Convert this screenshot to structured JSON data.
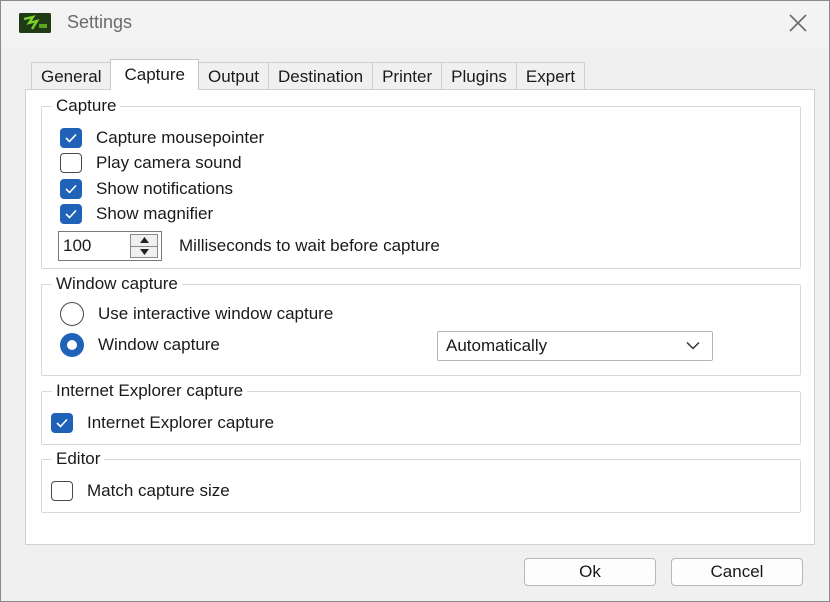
{
  "window": {
    "title": "Settings",
    "icons": {
      "app": "greenshot-app-icon",
      "close": "close-icon"
    }
  },
  "tabs": [
    {
      "label": "General",
      "active": false
    },
    {
      "label": "Capture",
      "active": true
    },
    {
      "label": "Output",
      "active": false
    },
    {
      "label": "Destination",
      "active": false
    },
    {
      "label": "Printer",
      "active": false
    },
    {
      "label": "Plugins",
      "active": false
    },
    {
      "label": "Expert",
      "active": false
    }
  ],
  "capture": {
    "group_label": "Capture",
    "capture_mousepointer": {
      "label": "Capture mousepointer",
      "checked": true
    },
    "play_camera_sound": {
      "label": "Play camera sound",
      "checked": false
    },
    "show_notifications": {
      "label": "Show notifications",
      "checked": true
    },
    "show_magnifier": {
      "label": "Show magnifier",
      "checked": true
    },
    "wait": {
      "value": "100",
      "label": "Milliseconds to wait before capture"
    }
  },
  "window_capture": {
    "group_label": "Window capture",
    "interactive": {
      "label": "Use interactive window capture",
      "selected": false
    },
    "window": {
      "label": "Window capture",
      "selected": true
    },
    "mode": {
      "selected": "Automatically"
    }
  },
  "ie_capture": {
    "group_label": "Internet Explorer capture",
    "checkbox": {
      "label": "Internet Explorer capture",
      "checked": true
    }
  },
  "editor": {
    "group_label": "Editor",
    "match_size": {
      "label": "Match capture size",
      "checked": false
    }
  },
  "buttons": {
    "ok": "Ok",
    "cancel": "Cancel"
  },
  "colors": {
    "accent": "#1f62b8",
    "panel": "#ffffff",
    "chrome": "#f0f0f0"
  }
}
